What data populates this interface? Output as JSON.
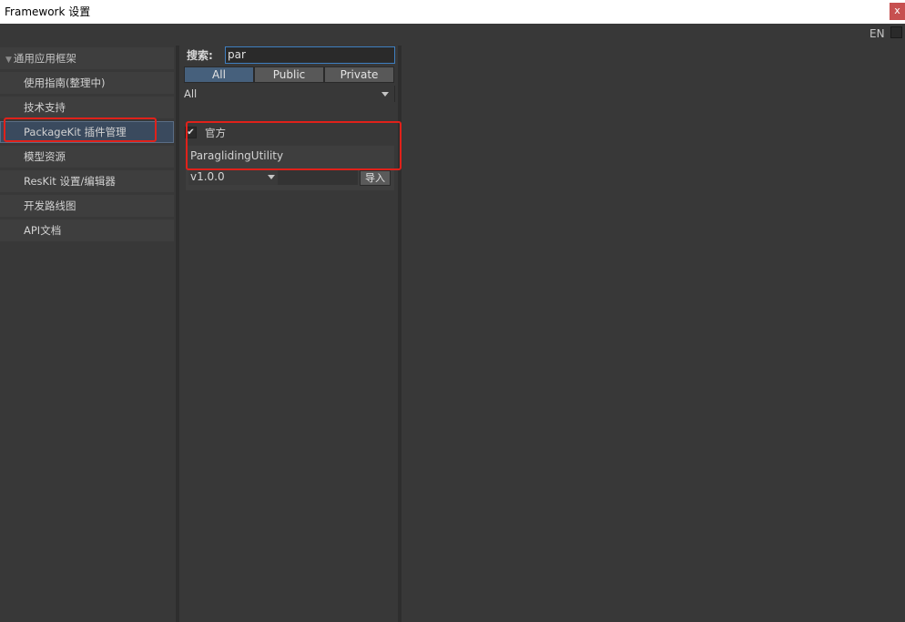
{
  "window": {
    "title": "Framework 设置",
    "close_label": "x"
  },
  "toolbar": {
    "language_label": "EN"
  },
  "sidebar": {
    "group_label": "通用应用框架",
    "items": [
      {
        "label": "使用指南(整理中)"
      },
      {
        "label": "技术支持"
      },
      {
        "label": "PackageKit 插件管理",
        "selected": true
      },
      {
        "label": "模型资源"
      },
      {
        "label": "ResKit 设置/编辑器"
      },
      {
        "label": "开发路线图"
      },
      {
        "label": "API文档"
      }
    ]
  },
  "package_manager": {
    "search_label": "搜索:",
    "search_value": "par",
    "tabs": [
      {
        "label": "All",
        "active": true
      },
      {
        "label": "Public"
      },
      {
        "label": "Private"
      }
    ],
    "category_filter": "All",
    "official_checkbox": {
      "label": "官方",
      "checked": true,
      "mark": "✔"
    },
    "packages": [
      {
        "name": "ParaglidingUtility",
        "version": "v1.0.0",
        "import_label": "导入"
      }
    ]
  },
  "colors": {
    "background": "#383838",
    "highlight": "#e0211a",
    "tab_active": "#46607c"
  }
}
